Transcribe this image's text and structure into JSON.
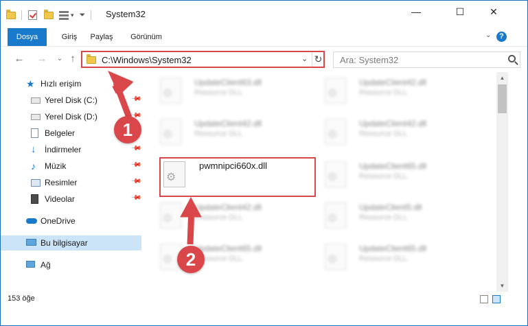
{
  "window": {
    "title": "System32",
    "minimize_glyph": "—",
    "maximize_glyph": "☐",
    "close_glyph": "✕"
  },
  "ribbon": {
    "tabs": [
      {
        "label": "Dosya"
      },
      {
        "label": "Giriş"
      },
      {
        "label": "Paylaş"
      },
      {
        "label": "Görünüm"
      }
    ],
    "help_label": "?",
    "collapse_glyph": "⌄"
  },
  "navigation": {
    "back_glyph": "←",
    "forward_glyph": "→",
    "recent_glyph": "⌄",
    "up_glyph": "↑"
  },
  "address": {
    "path": "C:\\Windows\\System32",
    "dropdown_glyph": "⌄",
    "refresh_glyph": "↻"
  },
  "search": {
    "placeholder": "Ara: System32"
  },
  "sidebar": {
    "quick_access": "Hızlı erişim",
    "items": [
      {
        "label": "Yerel Disk (C:)",
        "icon": "drive-icon"
      },
      {
        "label": "Yerel Disk (D:)",
        "icon": "drive-icon"
      },
      {
        "label": "Belgeler",
        "icon": "documents-icon"
      },
      {
        "label": "İndirmeler",
        "icon": "downloads-icon"
      },
      {
        "label": "Müzik",
        "icon": "music-icon"
      },
      {
        "label": "Resimler",
        "icon": "pictures-icon"
      },
      {
        "label": "Videolar",
        "icon": "videos-icon"
      }
    ],
    "onedrive": "OneDrive",
    "this_pc": "Bu bilgisayar",
    "network": "Ağ"
  },
  "files": {
    "items": [
      {
        "name": "UpdateClient63.dll",
        "type": "Resource DLL"
      },
      {
        "name": "UpdateClient42.dll",
        "type": "Resource DLL"
      },
      {
        "name": "UpdateClient42.dll",
        "type": "Resource DLL"
      },
      {
        "name": "UpdateClient42.dll",
        "type": "Resource DLL"
      },
      {
        "name": "pwmnipci660x.dll",
        "type": ""
      },
      {
        "name": "UpdateClient65.dll",
        "type": "Resource DLL"
      },
      {
        "name": "UpdateClient42.dll",
        "type": "Resource DLL"
      },
      {
        "name": "UpdateClient5.dll",
        "type": "Resource DLL"
      },
      {
        "name": "UpdateClient65.dll",
        "type": "Resource DLL"
      },
      {
        "name": "UpdateClient65.dll",
        "type": "Resource DLL"
      }
    ]
  },
  "status": {
    "count": "153 öğe"
  },
  "annotations": {
    "step1": "1",
    "step2": "2",
    "accent_color": "#d9474a"
  },
  "colors": {
    "accent_blue": "#1979ca",
    "selection": "#cce4f7"
  }
}
